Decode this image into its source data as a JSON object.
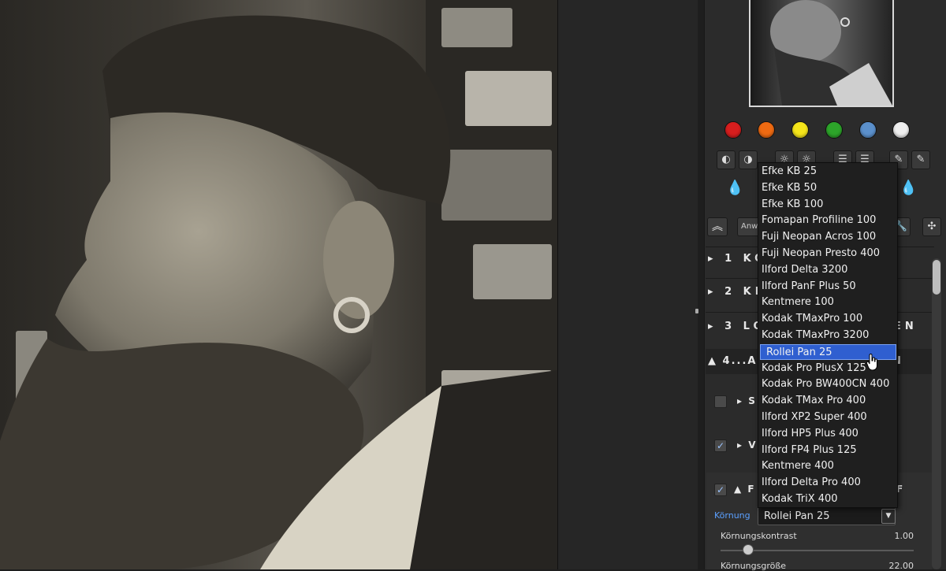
{
  "sidebar": {
    "apply_button_label": "Anw",
    "color_dots": [
      "#d81e1e",
      "#ee6a12",
      "#f5e51a",
      "#2da52a",
      "#5b90cc",
      "#eeeeee"
    ],
    "sections": [
      {
        "label": "1 KO",
        "expanded": false
      },
      {
        "label": "2 KR",
        "expanded": false
      },
      {
        "label": "3 LO",
        "expanded": false,
        "suffix": "EN"
      },
      {
        "label": "4...AB",
        "expanded": true,
        "suffix": "N"
      }
    ],
    "sub_items": [
      {
        "label": "S",
        "checked": false
      },
      {
        "label": "V",
        "checked": true
      },
      {
        "label": "F",
        "checked": true,
        "suffix": "F"
      }
    ],
    "grain": {
      "label": "Körnung",
      "selected": "Rollei Pan 25",
      "options": [
        "Efke KB 25",
        "Efke KB 50",
        "Efke KB 100",
        "Fomapan Profiline 100",
        "Fuji Neopan Acros 100",
        "Fuji Neopan Presto 400",
        "Ilford Delta 3200",
        "Ilford PanF Plus 50",
        "Kentmere 100",
        "Kodak TMaxPro 100",
        "Kodak TMaxPro 3200",
        "Rollei Pan 25",
        "Kodak Pro PlusX 125",
        "Kodak Pro BW400CN 400",
        "Kodak TMax Pro 400",
        "Ilford XP2 Super 400",
        "Ilford HP5 Plus 400",
        "Ilford FP4 Plus 125",
        "Kentmere 400",
        "Ilford Delta Pro 400",
        "Kodak TriX 400"
      ]
    },
    "sliders": [
      {
        "label": "Körnungskontrast",
        "value": "1.00",
        "fraction": 0.14
      },
      {
        "label": "Körnungsgröße",
        "value": "22.00",
        "fraction": 0.5
      }
    ]
  }
}
